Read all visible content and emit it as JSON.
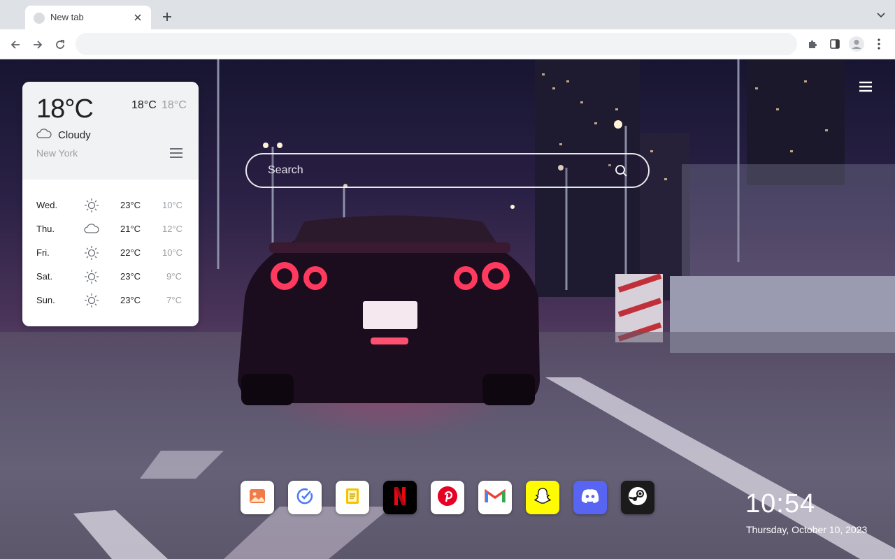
{
  "browser": {
    "tab_title": "New tab",
    "omnibox_value": ""
  },
  "search": {
    "placeholder": "Search"
  },
  "weather": {
    "current_temp": "18°C",
    "high": "18°C",
    "low": "18°C",
    "condition": "Cloudy",
    "city": "New York",
    "forecast": [
      {
        "day": "Wed.",
        "icon": "sun-icon",
        "high": "23°C",
        "low": "10°C"
      },
      {
        "day": "Thu.",
        "icon": "cloud-icon",
        "high": "21°C",
        "low": "12°C"
      },
      {
        "day": "Fri.",
        "icon": "sun-icon",
        "high": "22°C",
        "low": "10°C"
      },
      {
        "day": "Sat.",
        "icon": "sun-icon",
        "high": "23°C",
        "low": "9°C"
      },
      {
        "day": "Sun.",
        "icon": "sun-icon",
        "high": "23°C",
        "low": "7°C"
      }
    ]
  },
  "apps": [
    {
      "name": "photos",
      "icon": "photos-icon",
      "bg": "#ffffff"
    },
    {
      "name": "tasks",
      "icon": "check-circle-icon",
      "bg": "#ffffff"
    },
    {
      "name": "notes",
      "icon": "notes-icon",
      "bg": "#ffffff"
    },
    {
      "name": "netflix",
      "icon": "netflix-icon",
      "bg": "#000000"
    },
    {
      "name": "pinterest",
      "icon": "pinterest-icon",
      "bg": "#ffffff"
    },
    {
      "name": "gmail",
      "icon": "gmail-icon",
      "bg": "#ffffff"
    },
    {
      "name": "snapchat",
      "icon": "snapchat-icon",
      "bg": "#fffc00"
    },
    {
      "name": "discord",
      "icon": "discord-icon",
      "bg": "#5865f2"
    },
    {
      "name": "steam",
      "icon": "steam-icon",
      "bg": "#1b1b1b"
    }
  ],
  "clock": {
    "time": "10:54",
    "date": "Thursday, October 10, 2023"
  },
  "colors": {
    "chrome_bg": "#dee1e6",
    "accent_pink": "#ff2a6e"
  }
}
